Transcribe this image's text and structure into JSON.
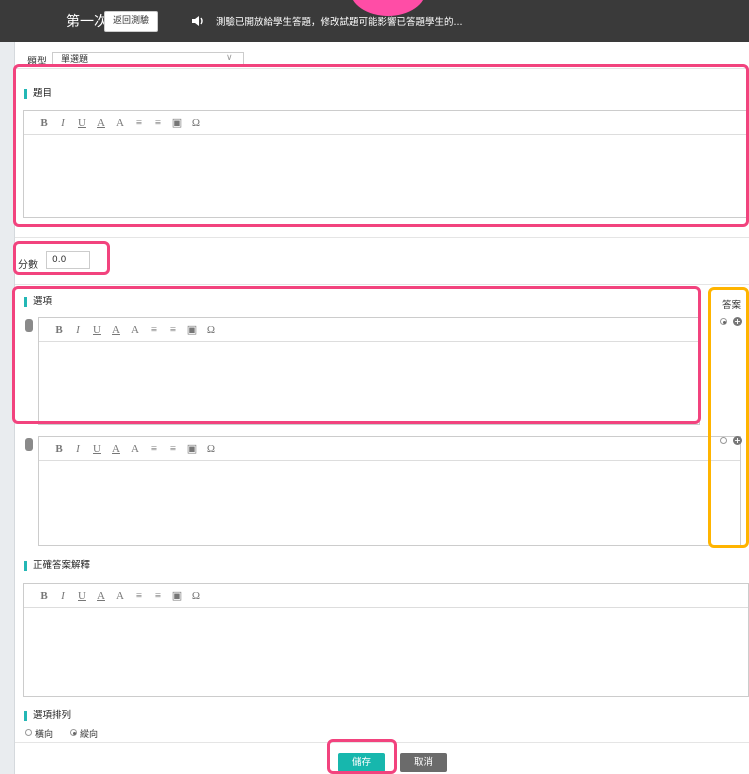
{
  "header": {
    "title": "第一次小考",
    "back_button": "返回測驗",
    "notice": "測驗已開放給學生答題，修改試題可能影響已答題學生的..."
  },
  "question_type": {
    "label": "題型",
    "value": "單選題"
  },
  "sections": {
    "question_label": "題目",
    "score_label": "分數",
    "score_value": "0.0",
    "options_label": "選項",
    "answer_label": "答案",
    "explanation_label": "正確答案解釋",
    "order_label": "選項排列",
    "order_horizontal": "橫向",
    "order_vertical": "縱向"
  },
  "toolbar": {
    "bold": "B",
    "italic": "I",
    "underline": "U",
    "font_color": "A",
    "bg_color": "A",
    "ordered_list": "≡",
    "unordered_list": "≡",
    "image": "▣",
    "special_char": "Ω"
  },
  "footer": {
    "save": "儲存",
    "cancel": "取消"
  },
  "colors": {
    "topbar": "#3a3a3a",
    "accent": "#17b7ad",
    "highlight_pink": "#f2437e",
    "highlight_yellow": "#ffb400"
  }
}
